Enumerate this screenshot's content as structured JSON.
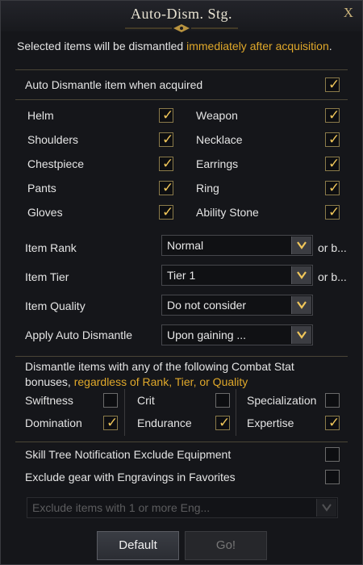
{
  "window": {
    "title": "Auto-Dism. Stg.",
    "close_label": "X"
  },
  "intro": {
    "text": "Selected items will be dismantled ",
    "highlight": "immediately after acquisition",
    "end": "."
  },
  "auto_dismantle": {
    "label": "Auto Dismantle item when acquired",
    "checked": true
  },
  "equipment": {
    "left": [
      {
        "label": "Helm",
        "checked": true
      },
      {
        "label": "Shoulders",
        "checked": true
      },
      {
        "label": "Chestpiece",
        "checked": true
      },
      {
        "label": "Pants",
        "checked": true
      },
      {
        "label": "Gloves",
        "checked": true
      }
    ],
    "right": [
      {
        "label": "Weapon",
        "checked": true
      },
      {
        "label": "Necklace",
        "checked": true
      },
      {
        "label": "Earrings",
        "checked": true
      },
      {
        "label": "Ring",
        "checked": true
      },
      {
        "label": "Ability Stone",
        "checked": true
      }
    ]
  },
  "filters": {
    "rank": {
      "label": "Item Rank",
      "value": "Normal",
      "suffix": "or b..."
    },
    "tier": {
      "label": "Item Tier",
      "value": "Tier 1",
      "suffix": "or b..."
    },
    "quality": {
      "label": "Item Quality",
      "value": "Do not consider"
    },
    "apply": {
      "label": "Apply Auto Dismantle",
      "value": "Upon gaining ..."
    }
  },
  "combat": {
    "line1": "Dismantle items with any of the following Combat Stat",
    "line2a": "bonuses, ",
    "line2b": "regardless of Rank, Tier, or Quality",
    "stats": [
      {
        "label": "Swiftness",
        "checked": false
      },
      {
        "label": "Crit",
        "checked": false
      },
      {
        "label": "Specialization",
        "checked": false
      },
      {
        "label": "Domination",
        "checked": true
      },
      {
        "label": "Endurance",
        "checked": true
      },
      {
        "label": "Expertise",
        "checked": true
      }
    ]
  },
  "options": [
    {
      "label": "Skill Tree Notification Exclude Equipment",
      "checked": false
    },
    {
      "label": "Exclude gear with Engravings in Favorites",
      "checked": false
    }
  ],
  "engraving_dropdown": {
    "value": "Exclude items with 1 or more Eng..."
  },
  "buttons": {
    "default": "Default",
    "go": "Go!"
  },
  "colors": {
    "accent_gold": "#e0a82a",
    "check_gold": "#f0c65a",
    "background": "#15161a"
  }
}
